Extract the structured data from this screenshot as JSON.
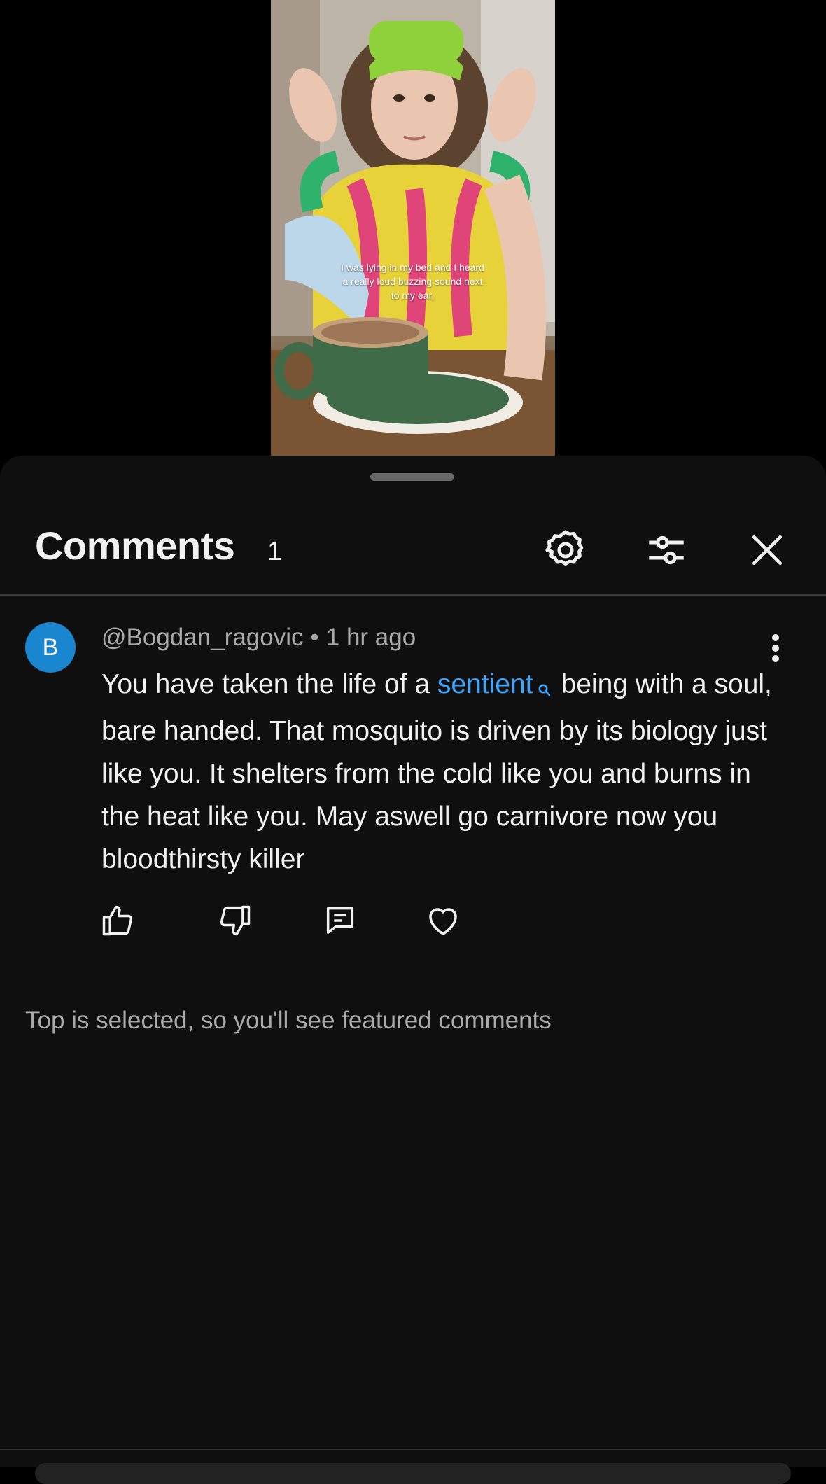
{
  "video": {
    "caption": "I was lying in my bed and I heard a really loud buzzing sound next to my ear,"
  },
  "sheet": {
    "title": "Comments",
    "count": "1",
    "icons": [
      "settings-gear-icon",
      "filter-sliders-icon",
      "close-icon"
    ]
  },
  "comment": {
    "avatar_initial": "B",
    "avatar_color": "#1a86d0",
    "author": "@Bogdan_ragovic",
    "separator": "•",
    "time": "1 hr ago",
    "text_before_link": "You have taken the life of a ",
    "link_word": "sentient",
    "text_after_link": "being with a soul, bare handed. That mosquito is driven by its biology just like you. It shelters from the cold like you and burns in the heat like you. May aswell go carnivore now you bloodthirsty killer",
    "link_color": "#3ea6ff",
    "actions": [
      "like-icon",
      "dislike-icon",
      "reply-icon",
      "heart-icon"
    ]
  },
  "footer_note": "Top is selected, so you'll see featured comments"
}
